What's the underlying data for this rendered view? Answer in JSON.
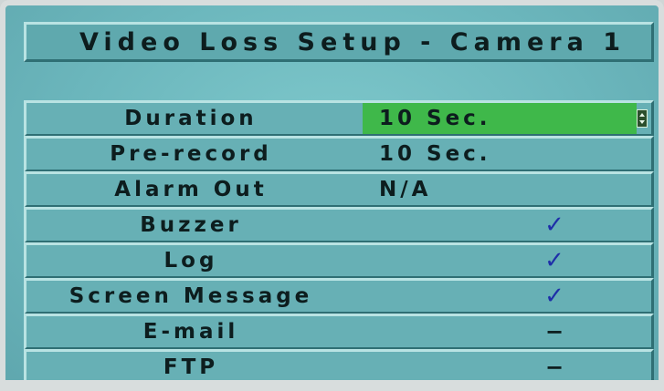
{
  "title": "Video Loss Setup - Camera 1",
  "rows": [
    {
      "label": "Duration",
      "value": "10 Sec.",
      "mark": ""
    },
    {
      "label": "Pre-record",
      "value": "10 Sec.",
      "mark": ""
    },
    {
      "label": "Alarm Out",
      "value": "N/A",
      "mark": ""
    },
    {
      "label": "Buzzer",
      "value": "",
      "mark": "✓"
    },
    {
      "label": "Log",
      "value": "",
      "mark": "✓"
    },
    {
      "label": "Screen Message",
      "value": "",
      "mark": "✓"
    },
    {
      "label": "E-mail",
      "value": "",
      "mark": "−"
    },
    {
      "label": "FTP",
      "value": "",
      "mark": "−"
    }
  ],
  "colors": {
    "background": "#6cb7bd",
    "selected": "#3fb84a",
    "checkmark": "#1e2fa8",
    "text": "#0d1d1e"
  },
  "icons": {
    "spinner": "up-down-spinner-icon",
    "check": "checkmark-icon",
    "dash": "dash-icon"
  }
}
